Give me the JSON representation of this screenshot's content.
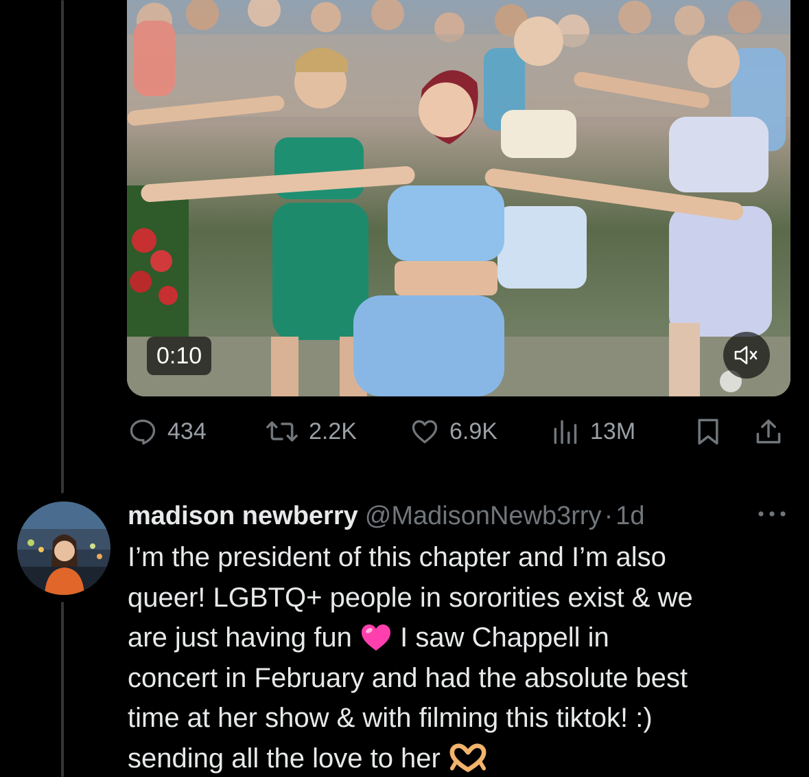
{
  "media": {
    "duration": "0:10",
    "mute_icon": "speaker-muted-icon"
  },
  "actions": {
    "replies": "434",
    "retweets": "2.2K",
    "likes": "6.9K",
    "views": "13M",
    "icons": [
      "reply-icon",
      "retweet-icon",
      "like-icon",
      "views-icon",
      "bookmark-icon",
      "share-icon"
    ]
  },
  "reply_tweet": {
    "display_name": "madison newberry",
    "handle": "@MadisonNewb3rry",
    "separator": "·",
    "age": "1d",
    "lines": [
      "I’m the president of this chapter and I’m also",
      "queer! LGBTQ+ people in sororities exist & we",
      "are just having fun",
      "I saw Chappell in",
      "concert in February and had the absolute best",
      "time at her show & with filming this tiktok! :)",
      "sending all the love to her"
    ],
    "emojis": [
      "pink-heart-emoji",
      "heart-hands-emoji"
    ]
  },
  "colors": {
    "background": "#000000",
    "text": "#e7e9ea",
    "secondary": "#71767b",
    "thread_line": "#333639",
    "heart_emoji": "#ff3fae"
  }
}
